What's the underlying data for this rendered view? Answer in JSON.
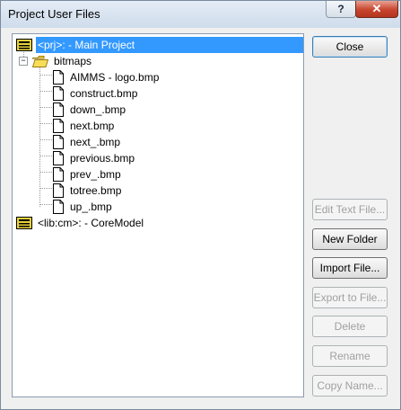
{
  "window": {
    "title": "Project User Files",
    "help_label": "?",
    "close_label": "✕"
  },
  "tree": {
    "items": [
      {
        "label": "<prj>:  - Main Project",
        "icon": "project-icon",
        "selected": true
      },
      {
        "label": "bitmaps",
        "icon": "folder-open-icon",
        "expanded": true
      },
      {
        "label": "AIMMS - logo.bmp",
        "icon": "file-icon"
      },
      {
        "label": "construct.bmp",
        "icon": "file-icon"
      },
      {
        "label": "down_.bmp",
        "icon": "file-icon"
      },
      {
        "label": "next.bmp",
        "icon": "file-icon"
      },
      {
        "label": "next_.bmp",
        "icon": "file-icon"
      },
      {
        "label": "previous.bmp",
        "icon": "file-icon"
      },
      {
        "label": "prev_.bmp",
        "icon": "file-icon"
      },
      {
        "label": "totree.bmp",
        "icon": "file-icon"
      },
      {
        "label": "up_.bmp",
        "icon": "file-icon"
      },
      {
        "label": "<lib:cm>:  - CoreModel",
        "icon": "library-icon"
      }
    ]
  },
  "buttons": {
    "close": "Close",
    "edit_text_file": "Edit Text File...",
    "new_folder": "New Folder",
    "import_file": "Import File...",
    "export_to_file": "Export to File...",
    "delete": "Delete",
    "rename": "Rename",
    "copy_name": "Copy Name..."
  },
  "colors": {
    "selection": "#3399ff",
    "folder": "#f5d23a",
    "project": "#e8d33b"
  }
}
